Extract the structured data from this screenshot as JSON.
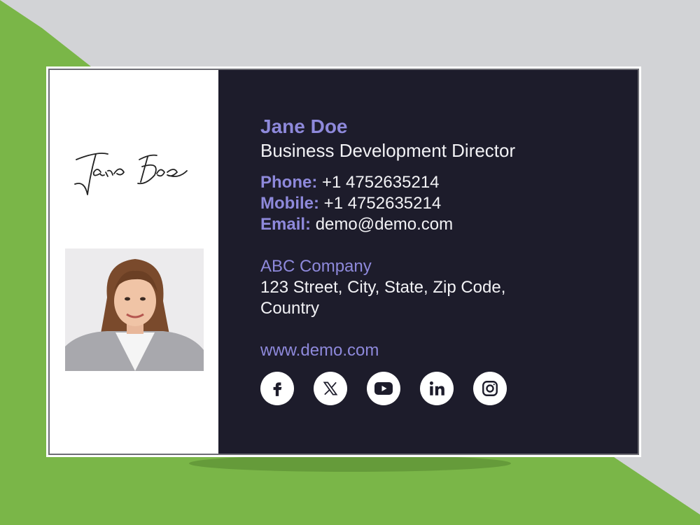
{
  "contact_card": {
    "name": "Jane Doe",
    "job_title": "Business Development Director",
    "phone": {
      "label": "Phone:",
      "value": "+1 4752635214"
    },
    "mobile": {
      "label": "Mobile:",
      "value": "+1 4752635214"
    },
    "email": {
      "label": "Email:",
      "value": "demo@demo.com"
    },
    "company": "ABC Company",
    "address": "123 Street, City, State, Zip Code, Country",
    "website": "www.demo.com",
    "signature_text": "Jane Doe"
  },
  "social_icons": [
    "facebook-icon",
    "x-icon",
    "youtube-icon",
    "linkedin-icon",
    "instagram-icon"
  ],
  "colors": {
    "accent": "#8e89db",
    "panel_dark": "#1d1c2b",
    "background_green": "#7ab648",
    "background_gray": "#cfd1d4"
  }
}
